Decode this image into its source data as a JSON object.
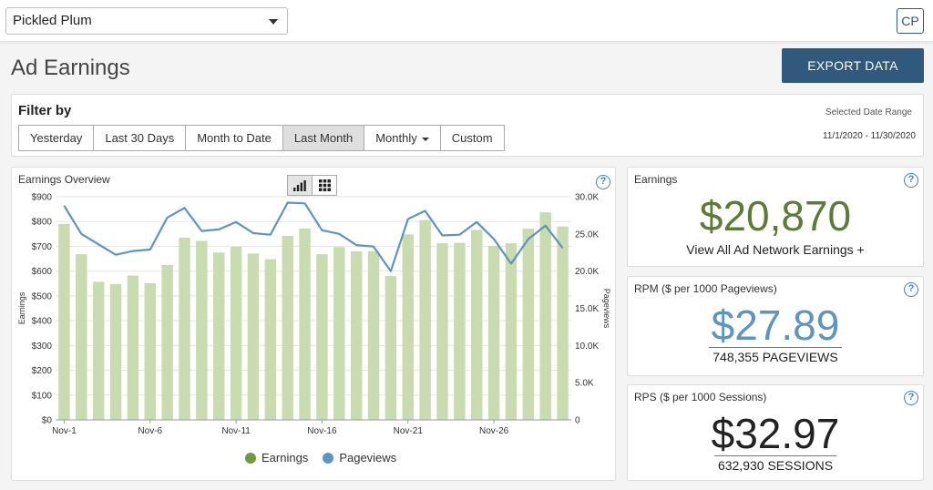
{
  "header": {
    "site_name": "Pickled Plum",
    "user_initials": "CP"
  },
  "page": {
    "title": "Ad Earnings",
    "export_label": "EXPORT DATA"
  },
  "filter": {
    "title": "Filter by",
    "buttons": [
      "Yesterday",
      "Last 30 Days",
      "Month to Date",
      "Last Month",
      "Monthly",
      "Custom"
    ],
    "active": "Last Month",
    "date_range_label": "Selected Date Range",
    "date_range_value": "11/1/2020 - 11/30/2020"
  },
  "overview": {
    "title": "Earnings Overview",
    "help": "?",
    "legend": {
      "earnings": "Earnings",
      "pageviews": "Pageviews"
    }
  },
  "chart_data": {
    "type": "bar",
    "xlabel": "",
    "ylabel": "Earnings",
    "y2label": "Pageviews",
    "ylim": [
      0,
      900
    ],
    "y2lim": [
      0,
      30000
    ],
    "yticks": [
      "$0",
      "$100",
      "$200",
      "$300",
      "$400",
      "$500",
      "$600",
      "$700",
      "$800",
      "$900"
    ],
    "y2ticks": [
      "0",
      "5.0K",
      "10.0K",
      "15.0K",
      "20.0K",
      "25.0K",
      "30.0K"
    ],
    "categories": [
      "Nov-1",
      "Nov-2",
      "Nov-3",
      "Nov-4",
      "Nov-5",
      "Nov-6",
      "Nov-7",
      "Nov-8",
      "Nov-9",
      "Nov-10",
      "Nov-11",
      "Nov-12",
      "Nov-13",
      "Nov-14",
      "Nov-15",
      "Nov-16",
      "Nov-17",
      "Nov-18",
      "Nov-19",
      "Nov-20",
      "Nov-21",
      "Nov-22",
      "Nov-23",
      "Nov-24",
      "Nov-25",
      "Nov-26",
      "Nov-27",
      "Nov-28",
      "Nov-29",
      "Nov-30"
    ],
    "xtick_labels": [
      "Nov-1",
      "Nov-6",
      "Nov-11",
      "Nov-16",
      "Nov-21",
      "Nov-26"
    ],
    "series": [
      {
        "name": "Earnings",
        "type": "bar",
        "axis": "left",
        "color": "#c8dcb0",
        "values": [
          790,
          668,
          557,
          548,
          582,
          551,
          625,
          735,
          722,
          675,
          698,
          671,
          648,
          742,
          772,
          668,
          697,
          680,
          680,
          580,
          748,
          806,
          713,
          714,
          766,
          702,
          712,
          771,
          837,
          780
        ]
      },
      {
        "name": "Pageviews",
        "type": "line",
        "axis": "right",
        "color": "#5b95c3",
        "values": [
          28800,
          25000,
          23600,
          22200,
          22700,
          22900,
          27200,
          28500,
          25400,
          25600,
          26600,
          25100,
          24900,
          29200,
          29100,
          25500,
          25000,
          23500,
          23300,
          20000,
          27000,
          28100,
          24800,
          24900,
          26600,
          24300,
          21000,
          24300,
          26100,
          23100
        ]
      }
    ]
  },
  "kpis": {
    "earnings": {
      "label": "Earnings",
      "value": "$20,870",
      "link": "View All Ad Network Earnings +",
      "color": "#5a7d34"
    },
    "rpm": {
      "label": "RPM ($ per 1000 Pageviews)",
      "value": "$27.89",
      "sub": "748,355 PAGEVIEWS",
      "color": "#5b95c3"
    },
    "rps": {
      "label": "RPS ($ per 1000 Sessions)",
      "value": "$32.97",
      "sub": "632,930 SESSIONS",
      "color": "#222222"
    }
  }
}
